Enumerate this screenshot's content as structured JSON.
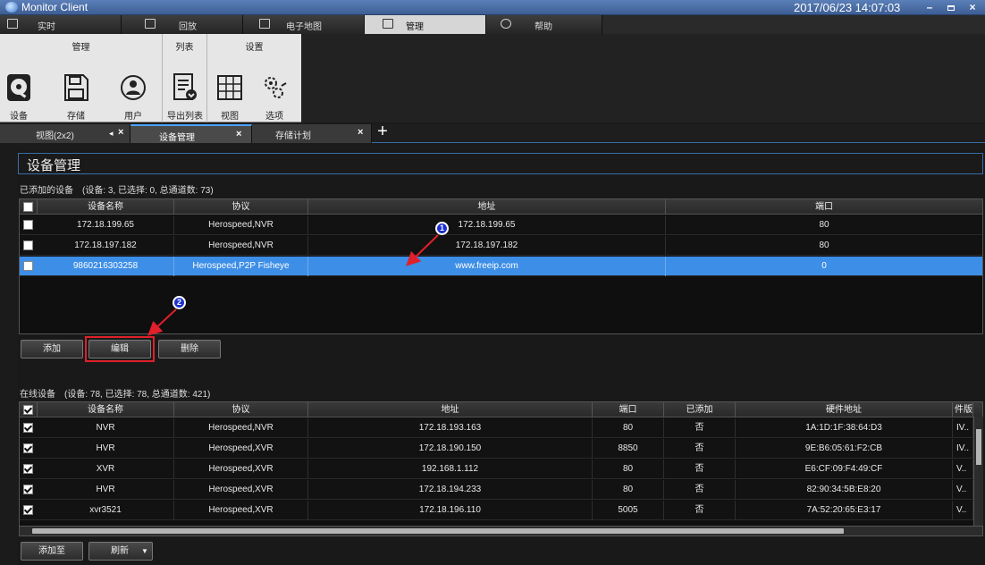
{
  "window": {
    "title": "Monitor Client",
    "datetime": "2017/06/23 14:07:03"
  },
  "nav_tabs": [
    {
      "label": "实时",
      "icon": "monitor-icon"
    },
    {
      "label": "回放",
      "icon": "play-icon"
    },
    {
      "label": "电子地图",
      "icon": "map-icon"
    },
    {
      "label": "管理",
      "icon": "folder-icon",
      "active": true
    },
    {
      "label": "帮助",
      "icon": "help-icon"
    }
  ],
  "ribbon": {
    "group_manage": "管理",
    "group_list": "列表",
    "group_settings": "设置",
    "buttons": {
      "device": "设备",
      "storage": "存储",
      "user": "用户",
      "export": "导出列表",
      "view": "视图",
      "options": "选项"
    }
  },
  "doc_tabs": [
    {
      "label": "视图(2x2)"
    },
    {
      "label": "设备管理",
      "active": true
    },
    {
      "label": "存储计划"
    }
  ],
  "page": {
    "title": "设备管理"
  },
  "added": {
    "caption": "已添加的设备　(设备: 3, 已选择: 0, 总通道数: 73)",
    "columns": [
      "设备名称",
      "协议",
      "地址",
      "端口"
    ],
    "rows": [
      {
        "name": "172.18.199.65",
        "protocol": "Herospeed,NVR",
        "address": "172.18.199.65",
        "port": "80"
      },
      {
        "name": "172.18.197.182",
        "protocol": "Herospeed,NVR",
        "address": "172.18.197.182",
        "port": "80"
      },
      {
        "name": "9860216303258",
        "protocol": "Herospeed,P2P Fisheye",
        "address": "www.freeip.com",
        "port": "0",
        "selected": true
      }
    ],
    "buttons": {
      "add": "添加",
      "edit": "编辑",
      "delete": "删除"
    }
  },
  "online": {
    "caption": "在线设备　(设备: 78, 已选择: 78, 总通道数: 421)",
    "columns": [
      "设备名称",
      "协议",
      "地址",
      "端口",
      "已添加",
      "硬件地址",
      "件版"
    ],
    "rows": [
      {
        "name": "NVR",
        "protocol": "Herospeed,NVR",
        "address": "172.18.193.163",
        "port": "80",
        "added": "否",
        "mac": "1A:1D:1F:38:64:D3",
        "ver": "IV.."
      },
      {
        "name": "HVR",
        "protocol": "Herospeed,XVR",
        "address": "172.18.190.150",
        "port": "8850",
        "added": "否",
        "mac": "9E:B6:05:61:F2:CB",
        "ver": "IV.."
      },
      {
        "name": "XVR",
        "protocol": "Herospeed,XVR",
        "address": "192.168.1.112",
        "port": "80",
        "added": "否",
        "mac": "E6:CF:09:F4:49:CF",
        "ver": "V.."
      },
      {
        "name": "HVR",
        "protocol": "Herospeed,XVR",
        "address": "172.18.194.233",
        "port": "80",
        "added": "否",
        "mac": "82:90:34:5B:E8:20",
        "ver": "V.."
      },
      {
        "name": "xvr3521",
        "protocol": "Herospeed,XVR",
        "address": "172.18.196.110",
        "port": "5005",
        "added": "否",
        "mac": "7A:52:20:65:E3:17",
        "ver": "V.."
      }
    ],
    "buttons": {
      "add_to": "添加至",
      "refresh": "刷新"
    }
  },
  "annotations": {
    "badge1": "1",
    "badge2": "2"
  },
  "colors": {
    "accent": "#3d8ee6",
    "annotation_red": "#e0202a",
    "badge_blue": "#1d2fd0"
  }
}
